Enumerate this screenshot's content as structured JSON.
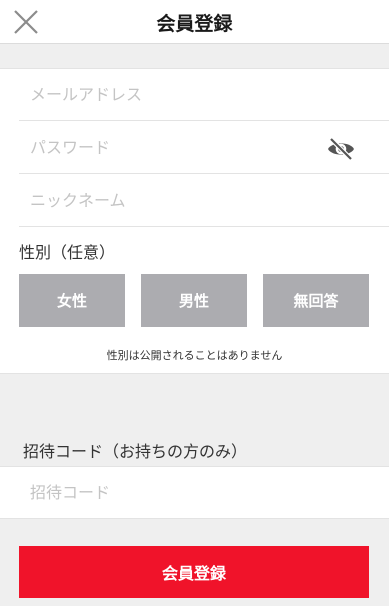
{
  "header": {
    "title": "会員登録",
    "close_icon": "close-icon"
  },
  "form": {
    "email": {
      "placeholder": "メールアドレス",
      "value": ""
    },
    "password": {
      "placeholder": "パスワード",
      "value": "",
      "toggle_icon": "eye-slash-icon"
    },
    "nickname": {
      "placeholder": "ニックネーム",
      "value": ""
    }
  },
  "gender": {
    "label": "性別（任意）",
    "options": [
      "女性",
      "男性",
      "無回答"
    ],
    "note": "性別は公開されることはありません"
  },
  "invite": {
    "label": "招待コード（お持ちの方のみ）",
    "placeholder": "招待コード",
    "value": ""
  },
  "submit": {
    "label": "会員登録"
  },
  "colors": {
    "accent": "#f0132a",
    "gender_button": "#acacb0",
    "background": "#efefef"
  }
}
